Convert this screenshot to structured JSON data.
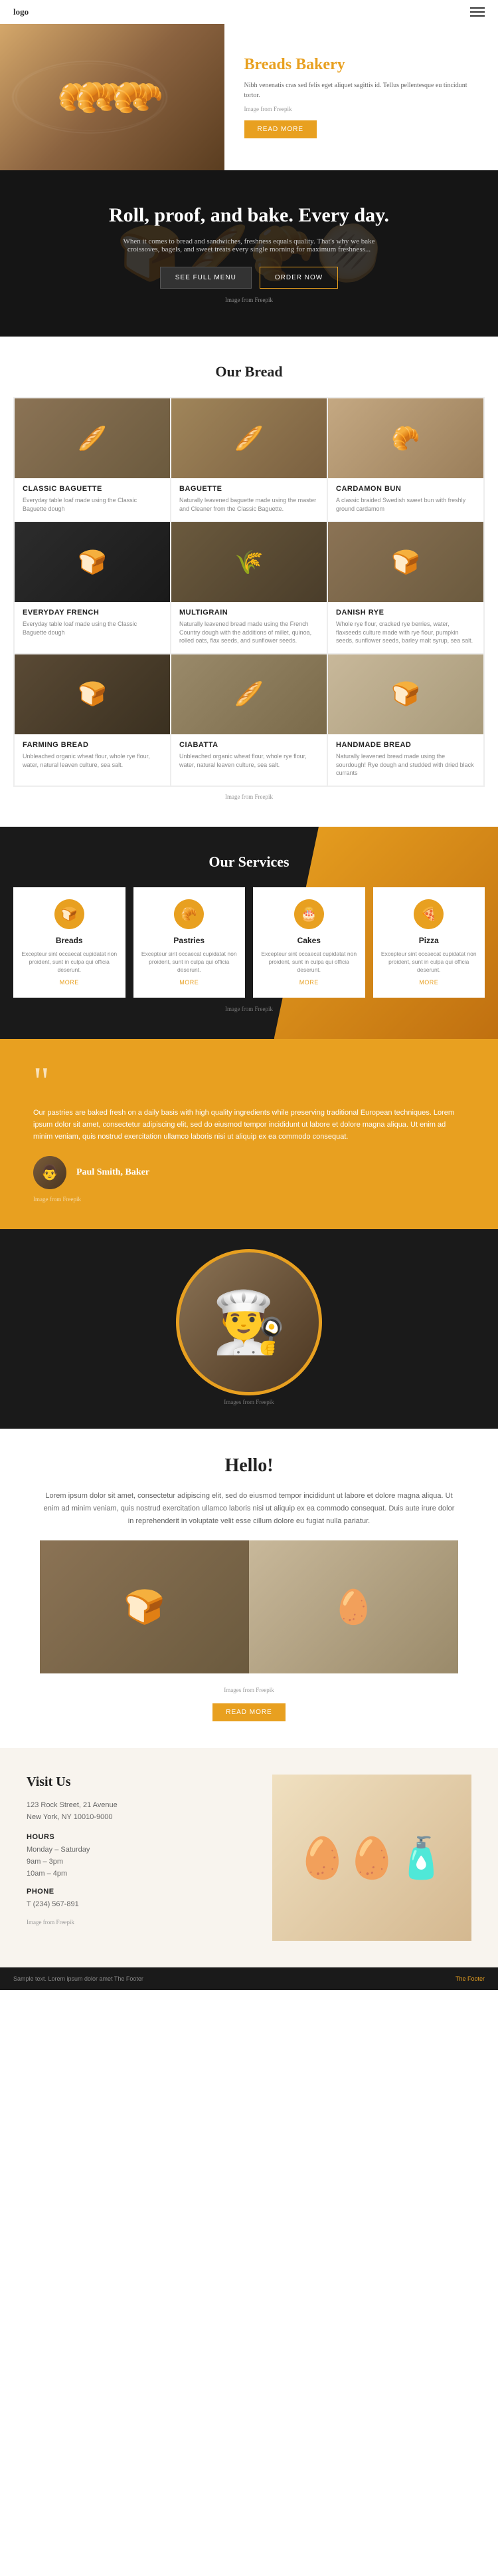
{
  "header": {
    "logo": "logo",
    "hamburger_label": "menu"
  },
  "hero": {
    "title": "Breads Bakery",
    "text": "Nibh venenatis cras sed felis eget aliquet sagittis id. Tellus pellentesque eu tincidunt tortor.",
    "image_credit": "Image from Freepik",
    "read_more_label": "READ MORE"
  },
  "banner": {
    "title": "Roll, proof, and bake. Every day.",
    "text": "When it comes to bread and sandwiches, freshness equals quality. That's why we bake croissoves, bagels, and sweet treats every single morning for maximum freshness...",
    "btn1_label": "SEE FULL MENU",
    "btn2_label": "ORDER NOW",
    "image_credit": "Image from Freepik"
  },
  "our_bread": {
    "section_title": "Our Bread",
    "items": [
      {
        "name": "Classic Baguette",
        "desc": "Everyday table loaf made using the Classic Baguette dough",
        "emoji": "🥖"
      },
      {
        "name": "Baguette",
        "desc": "Naturally leavened baguette made using the master and Cleaner from the Classic Baguette.",
        "emoji": "🥖"
      },
      {
        "name": "Cardamon Bun",
        "desc": "A classic braided Swedish sweet bun with freshly ground cardamom",
        "emoji": "🥐"
      },
      {
        "name": "Everyday French",
        "desc": "Everyday table loaf made using the Classic Baguette dough",
        "emoji": "🍞"
      },
      {
        "name": "Multigrain",
        "desc": "Naturally leavened bread made using the French Country dough with the additions of millet, quinoa, rolled oats, flax seeds, and sunflower seeds.",
        "emoji": "🌾"
      },
      {
        "name": "Danish Rye",
        "desc": "Whole rye flour, cracked rye berries, water, flaxseeds culture made with rye flour, pumpkin seeds, sunflower seeds, barley malt syrup, sea salt.",
        "emoji": "🍞"
      },
      {
        "name": "Farming Bread",
        "desc": "Unbleached organic wheat flour, whole rye flour, water, natural leaven culture, sea salt.",
        "emoji": "🍞"
      },
      {
        "name": "Ciabatta",
        "desc": "Unbleached organic wheat flour, whole rye flour, water, natural leaven culture, sea salt.",
        "emoji": "🥖"
      },
      {
        "name": "Handmade Bread",
        "desc": "Naturally leavened bread made using the sourdough! Rye dough and studded with dried black currants",
        "emoji": "🍞"
      }
    ],
    "image_credit": "Image from Freepik"
  },
  "services": {
    "section_title": "Our Services",
    "items": [
      {
        "name": "Breads",
        "icon": "🍞",
        "desc": "Excepteur sint occaecat cupidatat non proident, sunt in culpa qui officia deserunt.",
        "more": "MORE"
      },
      {
        "name": "Pastries",
        "icon": "🥐",
        "desc": "Excepteur sint occaecat cupidatat non proident, sunt in culpa qui officia deserunt.",
        "more": "MORE"
      },
      {
        "name": "Cakes",
        "icon": "🎂",
        "desc": "Excepteur sint occaecat cupidatat non proident, sunt in culpa qui officia deserunt.",
        "more": "MORE"
      },
      {
        "name": "Pizza",
        "icon": "🍕",
        "desc": "Excepteur sint occaecat cupidatat non proident, sunt in culpa qui officia deserunt.",
        "more": "MORE"
      }
    ],
    "image_credit": "Image from Freepik"
  },
  "testimonial": {
    "quote": "“",
    "text": "Our pastries are baked fresh on a daily basis with high quality ingredients while preserving traditional European techniques. Lorem ipsum dolor sit amet, consectetur adipiscing elit, sed do eiusmod tempor incididunt ut labore et dolore magna aliqua. Ut enim ad minim veniam, quis nostrud exercitation ullamco laboris nisi ut aliquip ex ea commodo consequat.",
    "author_name": "Paul Smith, Baker",
    "image_credit": "Image from Freepik"
  },
  "hello": {
    "baker_emoji": "👨‍🍳",
    "image_credit": "Images from Freepik"
  },
  "about": {
    "title": "Hello!",
    "text": "Lorem ipsum dolor sit amet, consectetur adipiscing elit, sed do eiusmod tempor incididunt ut labore et dolore magna aliqua. Ut enim ad minim veniam, quis nostrud exercitation ullamco laboris nisi ut aliquip ex ea commodo consequat. Duis aute irure dolor in reprehenderit in voluptate velit esse cillum dolore eu fugiat nulla pariatur.",
    "read_more_label": "READ MORE",
    "image_credit": "Images from Freepik"
  },
  "visit": {
    "title": "Visit Us",
    "address_line1": "123 Rock Street, 21 Avenue",
    "address_line2": "New York, NY 10010-9000",
    "hours_label": "HOURS",
    "hours_days": "Monday – Saturday",
    "hours_time1": "9am – 3pm",
    "hours_time2": "10am – 4pm",
    "phone_label": "PHONE",
    "phone": "T (234) 567-891",
    "image_credit": "Image from Freepik",
    "img_emoji": "🥚"
  },
  "footer": {
    "copyright": "Sample text. Lorem ipsum dolor amet The Footer",
    "link": "The Footer"
  }
}
